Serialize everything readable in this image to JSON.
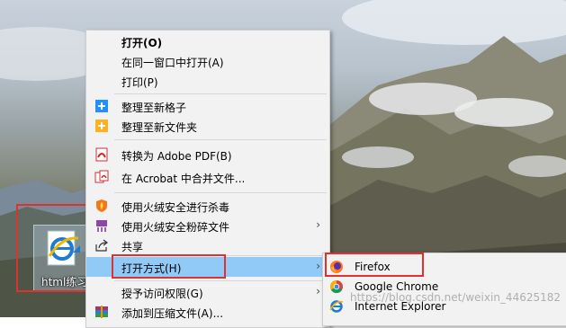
{
  "desktop": {
    "icon_label": "html练习"
  },
  "context_menu": {
    "items": [
      {
        "label": "打开(O)",
        "icon": "none"
      },
      {
        "label": "在同一窗口中打开(A)",
        "icon": "none"
      },
      {
        "label": "打印(P)",
        "icon": "none"
      },
      {
        "label": "整理至新格子",
        "icon": "fences-blue-plus-icon"
      },
      {
        "label": "整理至新文件夹",
        "icon": "fences-orange-plus-icon"
      },
      {
        "label": "转换为 Adobe PDF(B)",
        "icon": "adobe-pdf-icon"
      },
      {
        "label": "在 Acrobat 中合并文件...",
        "icon": "acrobat-combine-icon"
      },
      {
        "label": "使用火绒安全进行杀毒",
        "icon": "huorong-shield-icon"
      },
      {
        "label": "使用火绒安全粉碎文件",
        "icon": "huorong-shredder-icon"
      },
      {
        "label": "共享",
        "icon": "share-icon"
      },
      {
        "label": "打开方式(H)",
        "icon": "none"
      },
      {
        "label": "授予访问权限(G)",
        "icon": "none"
      },
      {
        "label": "添加到压缩文件(A)...",
        "icon": "winrar-icon"
      }
    ]
  },
  "open_with_submenu": {
    "items": [
      {
        "label": "Firefox",
        "icon": "firefox-icon"
      },
      {
        "label": "Google Chrome",
        "icon": "chrome-icon"
      },
      {
        "label": "Internet Explorer",
        "icon": "internet-explorer-icon"
      }
    ]
  },
  "watermark": "https://blog.csdn.net/weixin_44625182",
  "colors": {
    "menu_bg": "#f2f2f2",
    "highlight": "#91c9f7",
    "annotation_red": "#e03131"
  }
}
